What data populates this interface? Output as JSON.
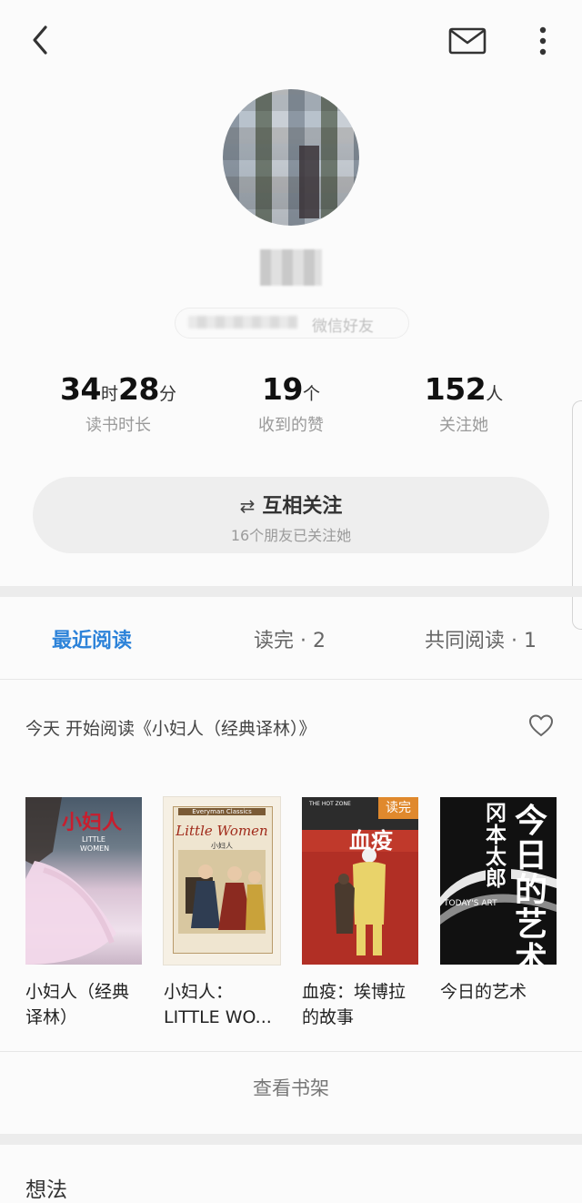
{
  "header": {
    "back_icon": "chevron-left-icon",
    "mail_icon": "mail-icon",
    "more_icon": "more-vertical-icon"
  },
  "profile": {
    "tag_text": "微信好友"
  },
  "stats": [
    {
      "num1": "34",
      "unit1": "时",
      "num2": "28",
      "unit2": "分",
      "label": "读书时长"
    },
    {
      "num1": "19",
      "unit1": "个",
      "label": "收到的赞"
    },
    {
      "num1": "152",
      "unit1": "人",
      "label": "关注她"
    }
  ],
  "follow": {
    "icon": "⇄",
    "label": "互相关注",
    "sub": "16个朋友已关注她"
  },
  "tabs": [
    {
      "label": "最近阅读",
      "active": true
    },
    {
      "label": "读完 · 2",
      "active": false
    },
    {
      "label": "共同阅读 · 1",
      "active": false
    }
  ],
  "activity": {
    "text": "今天 开始阅读《小妇人（经典译林）》"
  },
  "books": [
    {
      "title_line1": "小妇人（经典",
      "title_line2": "译林）",
      "cover_title": "小妇人",
      "cover_sub1": "LITTLE",
      "cover_sub2": "WOMEN"
    },
    {
      "title_line1": "小妇人：",
      "title_line2": "LITTLE WO...",
      "cover_series": "Everyman Classics",
      "cover_title": "Little Women",
      "cover_sub1": "小妇人"
    },
    {
      "title_line1": "血疫：埃博拉",
      "title_line2": "的故事",
      "badge": "读完",
      "cover_title": "血疫",
      "cover_sub1": "THE HOT ZONE"
    },
    {
      "title_line1": "今日的艺术",
      "title_line2": "",
      "cover_title": "今日的艺术",
      "cover_sub1": "冈本太郎",
      "cover_sub2": "TODAY'S ART"
    }
  ],
  "shelf_label": "查看书架",
  "ideas_label": "想法",
  "colors": {
    "accent": "#2d83d9",
    "badge": "#e0892d"
  }
}
